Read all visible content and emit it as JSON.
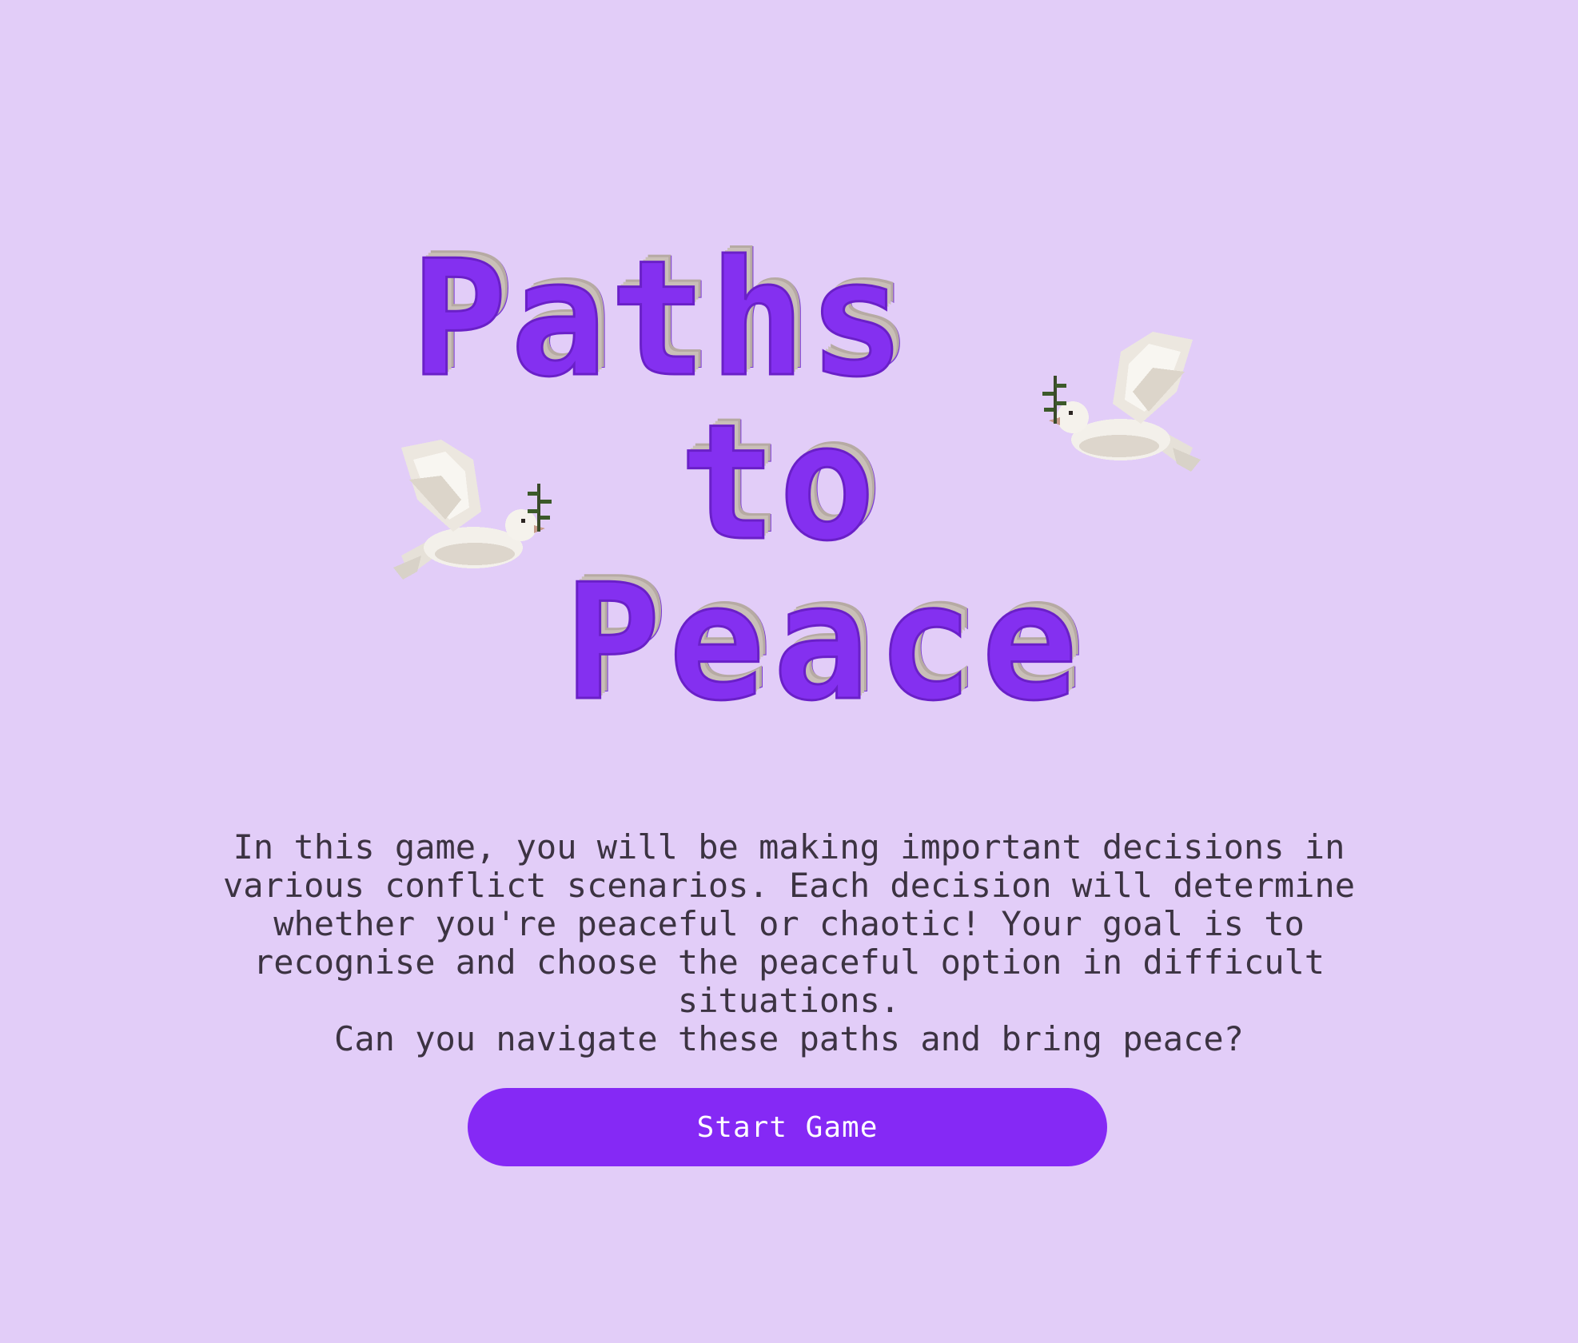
{
  "title": {
    "line1": "Paths",
    "line2": "to",
    "line3": "Peace"
  },
  "intro": {
    "paragraph": "In this game, you will be making important decisions in various conflict scenarios. Each decision will determine whether you're peaceful or chaotic! Your goal is to recognise and choose the peaceful option in difficult situations.",
    "question": "Can you navigate these paths and bring peace?"
  },
  "start_button": {
    "label": "Start Game"
  },
  "icons": {
    "left_dove": "dove-with-olive-branch-icon",
    "right_dove": "dove-with-olive-branch-icon"
  },
  "colors": {
    "background": "#e2cdf8",
    "accent": "#8529f5",
    "title": "#8430f0",
    "text": "#3c3342"
  }
}
